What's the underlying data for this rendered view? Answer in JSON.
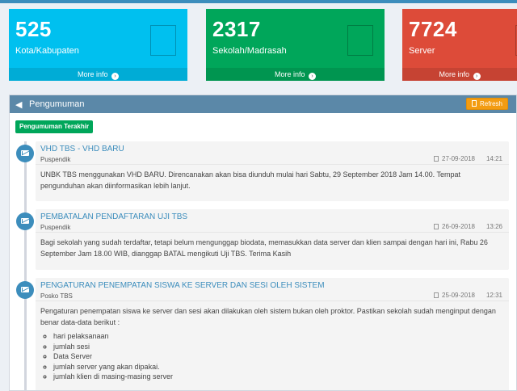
{
  "stats": [
    {
      "value": "525",
      "label": "Kota/Kabupaten",
      "more": "More info",
      "color": "#00c0ef"
    },
    {
      "value": "2317",
      "label": "Sekolah/Madrasah",
      "more": "More info",
      "color": "#00a65a"
    },
    {
      "value": "7724",
      "label": "Server",
      "more": "More info",
      "color": "#dd4b39"
    }
  ],
  "icons": {
    "megaphone": "bullhorn-icon",
    "refresh": "refresh-icon",
    "arrow": "arrow-circle-right-icon",
    "envelope": "envelope-icon",
    "clock": "clock-icon"
  },
  "panel": {
    "title": "Pengumuman",
    "refresh_label": "Refresh",
    "latest_label": "Pengumuman Terakhir"
  },
  "announcements": [
    {
      "title": "VHD TBS - VHD BARU",
      "author": "Puspendik",
      "date": "27-09-2018",
      "time": "14:21",
      "body": "UNBK TBS menggunakan VHD BARU. Direncanakan akan bisa diunduh mulai hari Sabtu, 29 September 2018 Jam 14.00. Tempat pengunduhan akan diinformasikan lebih lanjut."
    },
    {
      "title": "PEMBATALAN PENDAFTARAN UJI TBS",
      "author": "Puspendik",
      "date": "26-09-2018",
      "time": "13:26",
      "body": "Bagi sekolah yang sudah terdaftar, tetapi belum mengunggap biodata, memasukkan data server dan klien sampai dengan hari ini, Rabu 26 September Jam 18.00 WIB, dianggap BATAL mengikuti Uji TBS. Terima Kasih"
    },
    {
      "title": "PENGATURAN PENEMPATAN SISWA KE SERVER DAN SESI OLEH SISTEM",
      "author": "Posko TBS",
      "date": "25-09-2018",
      "time": "12:31",
      "body": "Pengaturan penempatan siswa ke server dan sesi akan dilakukan oleh sistem bukan oleh proktor. Pastikan sekolah sudah menginput dengan benar data-data berikut :",
      "list": [
        "hari pelaksanaan",
        "jumlah sesi",
        "Data Server",
        "jumlah server yang akan dipakai.",
        "jumlah klien di masing-masing server"
      ]
    }
  ]
}
